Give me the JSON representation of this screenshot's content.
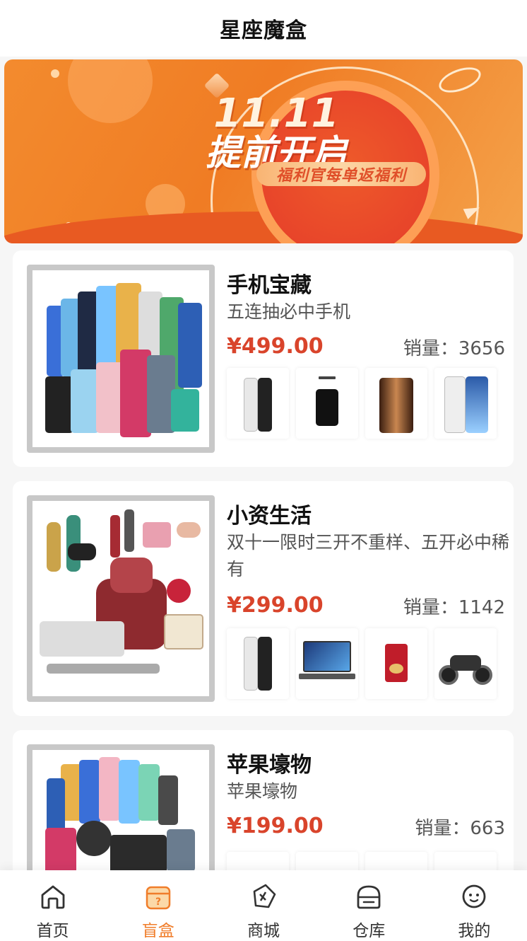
{
  "header": {
    "title": "星座魔盒"
  },
  "banner": {
    "date_text": "11.11",
    "headline": "提前开启",
    "ribbon": "福利官每单返福利"
  },
  "boxes": [
    {
      "name": "手机宝藏",
      "subtitle": "五连抽必中手机",
      "price": "¥499.00",
      "sales": "销量：3656",
      "products": [
        "folding-phone",
        "vertu-phone",
        "folding-phone-gold",
        "huawei-foldable"
      ]
    },
    {
      "name": "小资生活",
      "subtitle": "双十一限时三开不重样、五开必中稀有",
      "price": "¥299.00",
      "sales": "销量：1142",
      "products": [
        "folding-phone",
        "laptop",
        "ring-box",
        "motorcycle"
      ]
    },
    {
      "name": "苹果壕物",
      "subtitle": "苹果壕物",
      "price": "¥199.00",
      "sales": "销量：663",
      "products": []
    }
  ],
  "tabbar": {
    "items": [
      {
        "label": "首页",
        "icon": "home-icon",
        "active": false
      },
      {
        "label": "盲盒",
        "icon": "blind-box-icon",
        "active": true
      },
      {
        "label": "商城",
        "icon": "mall-icon",
        "active": false
      },
      {
        "label": "仓库",
        "icon": "warehouse-icon",
        "active": false
      },
      {
        "label": "我的",
        "icon": "profile-icon",
        "active": false
      }
    ]
  },
  "colors": {
    "accent": "#f07d2a",
    "price": "#d9442b",
    "banner": "#f07c24"
  }
}
